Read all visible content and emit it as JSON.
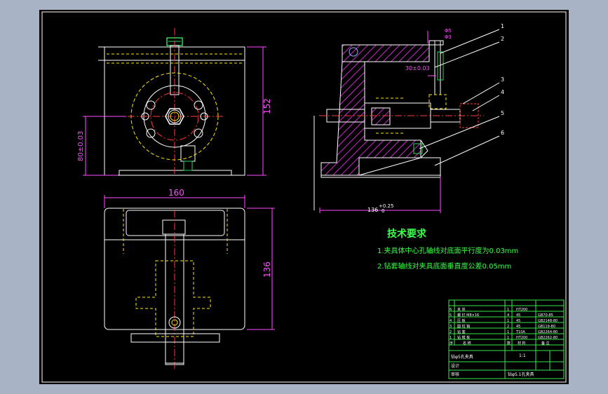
{
  "colors": {
    "frame_bg": "#a8b3c6",
    "paper": "#000000",
    "outline": "#ffffff",
    "center_line": "#ff3a3a",
    "hidden_line": "#ffe600",
    "dimension": "#ff4dff",
    "leader": "#ff4dff",
    "title_block": "#39e84a",
    "text_green": "#3cff4a",
    "hatch": "#ff33ff",
    "accent_green": "#2fd45a"
  },
  "dimensions": {
    "height_152": "152",
    "offset_80": "80±0.03",
    "width_160": "160",
    "depth_136": "136",
    "base_136": "136",
    "base_tol_plus": "+0.25",
    "base_tol_zero": "0",
    "small_30": "30±0.03",
    "dia_top_a": "Φ5",
    "dia_top_b": "Φ3"
  },
  "balloons": [
    "1",
    "2",
    "3",
    "4",
    "5",
    "6"
  ],
  "notes": {
    "title": "技术要求",
    "line1": "1.夹具体中心孔轴线对底面平行度为0.03mm",
    "line2": "2.钻套轴线对夹具底面垂直度公差0.05mm"
  },
  "title_block": {
    "rows": [
      {
        "no": "6",
        "name": "夹 体",
        "qty": "1",
        "mat": "HT200",
        "std": ""
      },
      {
        "no": "5",
        "name": "螺 钉 M8×16",
        "qty": "4",
        "mat": "45",
        "std": "GB70-85"
      },
      {
        "no": "4",
        "name": "压 板",
        "qty": "1",
        "mat": "45",
        "std": "GB2148-80"
      },
      {
        "no": "3",
        "name": "圆 柱 销",
        "qty": "2",
        "mat": "45",
        "std": "GB119-80"
      },
      {
        "no": "2",
        "name": "钻 套",
        "qty": "1",
        "mat": "T10A",
        "std": "GB2264-80"
      },
      {
        "no": "1",
        "name": "钻 模 板",
        "qty": "1",
        "mat": "HT200",
        "std": "GB2262-80"
      }
    ],
    "header": {
      "no": "序",
      "name": "名 称",
      "qty": "数",
      "mat": "材 料",
      "std": "备 注"
    },
    "drawing_title": "钻φ5孔夹具",
    "scale": "1:1",
    "designer": "设计",
    "checker": "审核",
    "drawing_no": "钻φ5.1孔夹具"
  }
}
